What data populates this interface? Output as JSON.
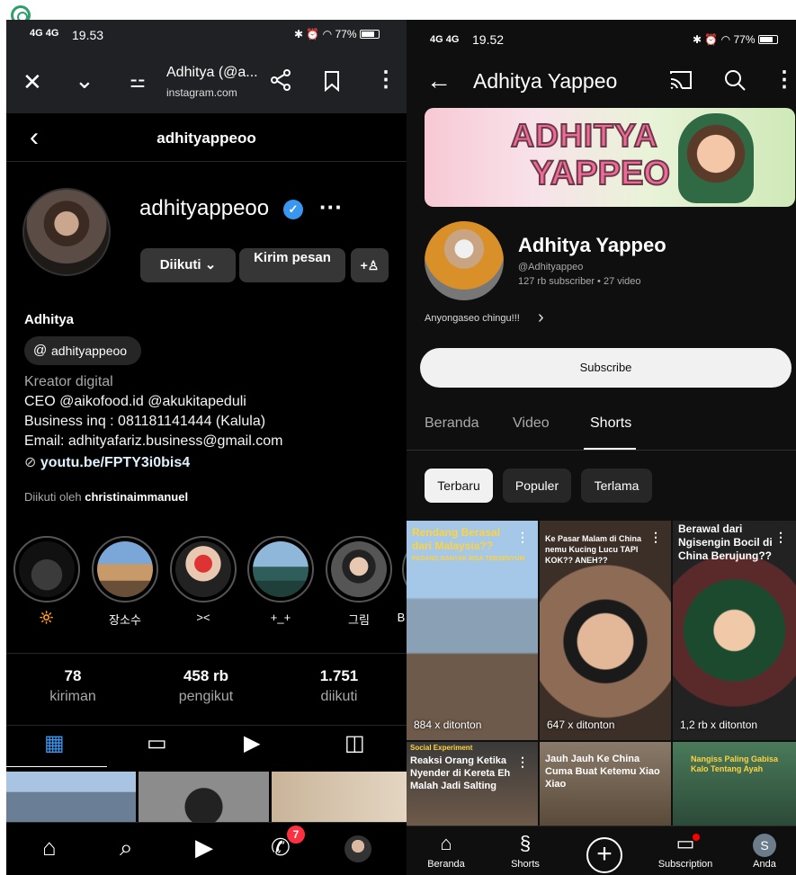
{
  "instagram": {
    "status": {
      "signal": "4G 4G",
      "time": "19.53",
      "battery": "77%"
    },
    "browser": {
      "title": "Adhitya (@a...",
      "url": "instagram.com"
    },
    "header_username": "adhityappeoo",
    "profile": {
      "username": "adhityappeoo",
      "follow_label": "Diikuti ⌄",
      "message_label": "Kirim pesan",
      "name": "Adhitya",
      "threads_handle": "adhityappeoo",
      "bio": [
        "Kreator digital",
        "CEO @aikofood.id @akukitapeduli",
        "Business inq : 081181141444 (Kalula)",
        "Email: adhityafariz.business@gmail.com"
      ],
      "link": "youtu.be/FPTY3i0bis4",
      "followed_by_prefix": "Diikuti oleh",
      "followed_by_name": "christinaimmanuel"
    },
    "highlights": [
      "🔆",
      "장소수",
      "><",
      "+_+",
      "그림",
      "B"
    ],
    "stats": [
      {
        "value": "78",
        "label": "kiriman"
      },
      {
        "value": "458 rb",
        "label": "pengikut"
      },
      {
        "value": "1.751",
        "label": "diikuti"
      }
    ],
    "messages_badge": "7"
  },
  "youtube": {
    "status": {
      "signal": "4G 4G",
      "time": "19.52",
      "battery": "77%"
    },
    "channel_title": "Adhitya Yappeo",
    "banner_line1": "ADHITYA",
    "banner_line2": "YAPPEO",
    "channel_name": "Adhitya Yappeo",
    "handle": "@Adhityappeo",
    "meta": "127 rb subscriber • 27 video",
    "description": "Anyongaseo chingu!!!",
    "subscribe_label": "Subscribe",
    "tabs": [
      "Beranda",
      "Video",
      "Shorts"
    ],
    "chips": [
      "Terbaru",
      "Populer",
      "Terlama"
    ],
    "shorts": [
      {
        "caption": "Rendang Berasal dari Malaysia??",
        "sub": "PADANG BANYAK BISA TERSENYUM",
        "views": "884 x ditonton"
      },
      {
        "caption": "Ke Pasar Malam di China nemu Kucing Lucu TAPI KOK?? ANEH??",
        "sub": "",
        "views": "647 x ditonton"
      },
      {
        "caption": "Berawal dari Ngisengin Bocil di China Berujung??",
        "sub": "",
        "views": "1,2 rb x ditonton"
      },
      {
        "caption": "Reaksi Orang Ketika Nyender di Kereta Eh Malah Jadi Salting",
        "sub": "Social Experiment",
        "views": ""
      },
      {
        "caption": "Jauh Jauh Ke China Cuma Buat Ketemu Xiao Xiao",
        "sub": "",
        "views": ""
      },
      {
        "caption": "Nangiss Paling Gabisa Kalo Tentang Ayah",
        "sub": "",
        "views": ""
      }
    ],
    "bottom_nav": [
      "Beranda",
      "Shorts",
      "Subscription",
      "Anda"
    ],
    "avatar_letter": "S"
  }
}
